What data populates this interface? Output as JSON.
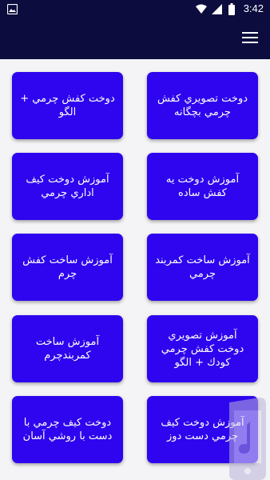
{
  "status_bar": {
    "time": "3:42"
  },
  "colors": {
    "app_bar": "#0c0c3e",
    "card": "#2e05ee",
    "background": "#f4f4f6"
  },
  "app_bar": {
    "menu_icon": "hamburger-menu-icon"
  },
  "cards": [
    {
      "label": "دوخت کفش چرمي + الگو"
    },
    {
      "label": "دوخت  تصويري كفش چرمي بچگانه"
    },
    {
      "label": "آموزش دوخت کیف اداري چرمي"
    },
    {
      "label": "آموزش دوخت يه كفش ساده"
    },
    {
      "label": "آموزش ساخت کفش چرم"
    },
    {
      "label": "آموزش ساخت کمربند چرمي"
    },
    {
      "label": "آموزش ساخت کمربندچرم"
    },
    {
      "label": "آموزش تصويري دوخت كفش چرمي كودك + الگو"
    },
    {
      "label": "دوخت کیف چرمي با دست با روشي آسان"
    },
    {
      "label": "آموزش دوخت کیف چرمي دست دوز"
    }
  ]
}
